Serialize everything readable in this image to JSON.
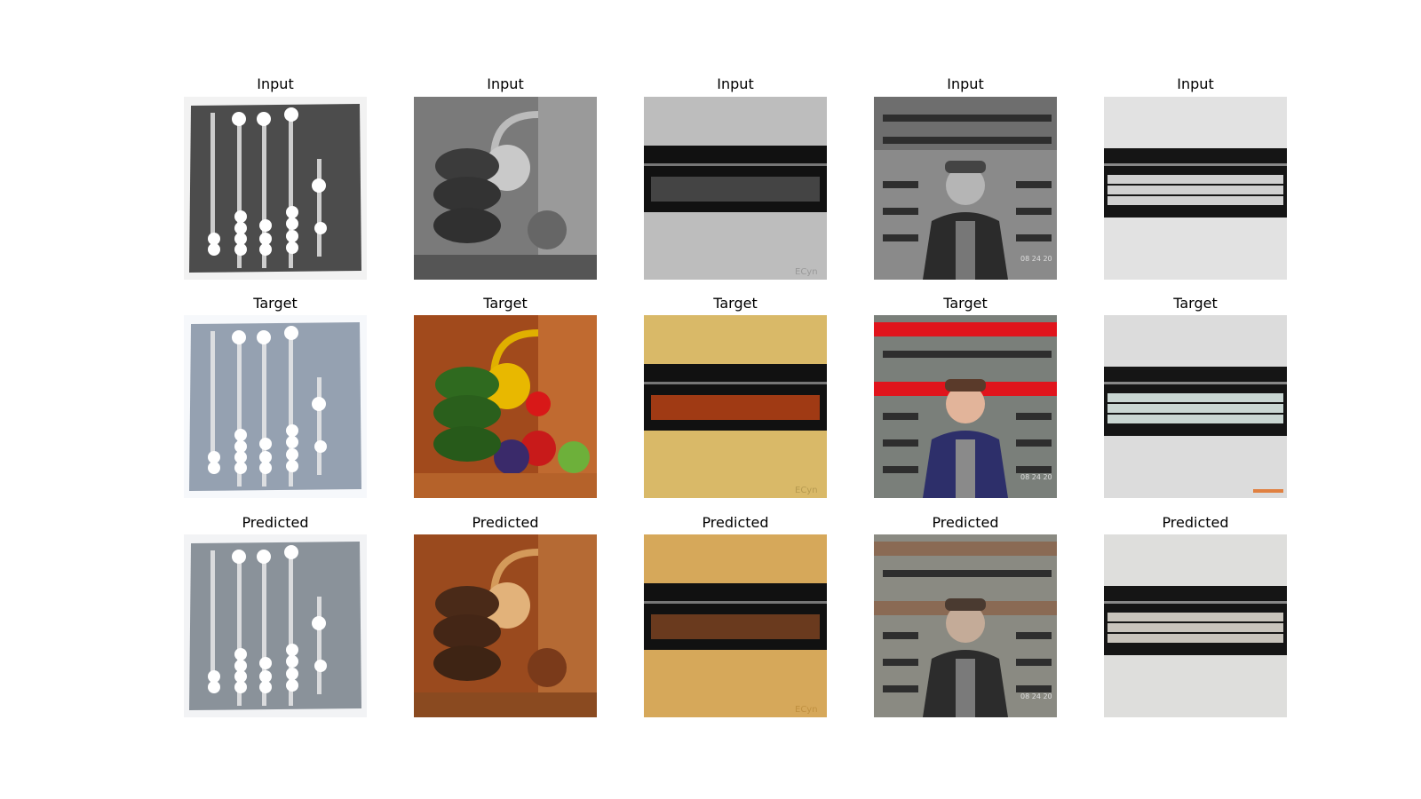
{
  "rows": [
    {
      "label": "Input"
    },
    {
      "label": "Target"
    },
    {
      "label": "Predicted"
    }
  ],
  "columns": [
    {
      "subject": "engraved abacus"
    },
    {
      "subject": "colorful bead toy close-up"
    },
    {
      "subject": "abacus on textured surface"
    },
    {
      "subject": "man in front of giant abacus"
    },
    {
      "subject": "soroban on white wall"
    }
  ],
  "watermarks": {
    "col3": "ECyn",
    "col4": "08 24 20"
  }
}
